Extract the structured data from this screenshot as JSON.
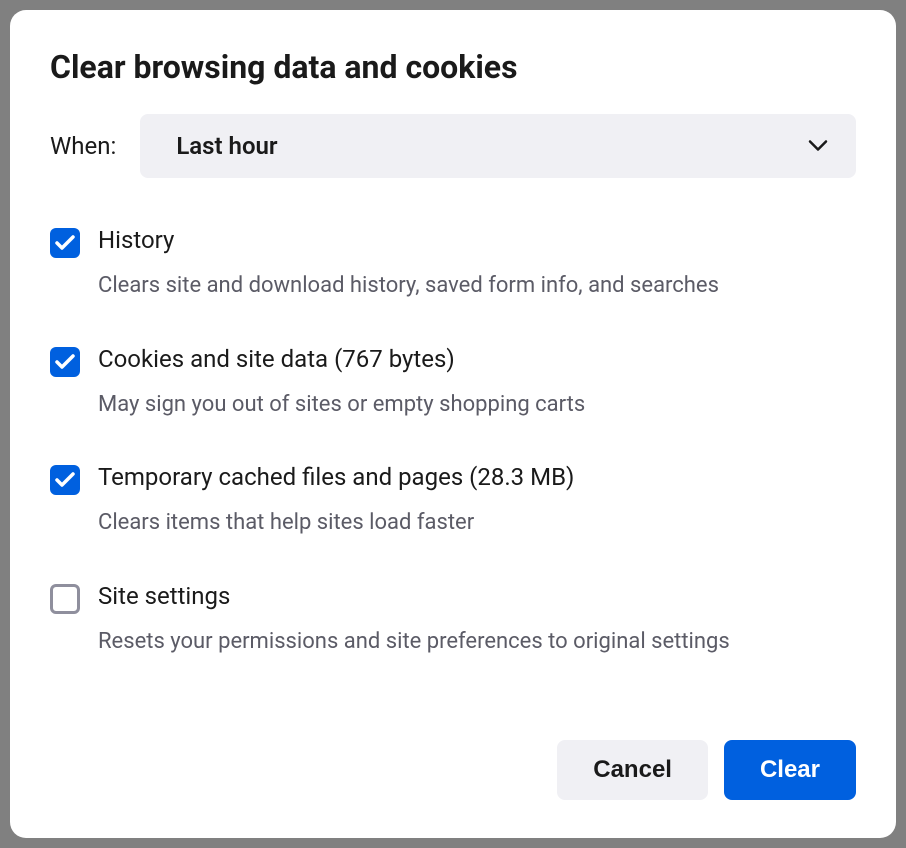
{
  "dialog": {
    "title": "Clear browsing data and cookies",
    "when_label": "When:",
    "when_value": "Last hour",
    "options": [
      {
        "checked": true,
        "label": "History",
        "description": "Clears site and download history, saved form info, and searches"
      },
      {
        "checked": true,
        "label": "Cookies and site data (767 bytes)",
        "description": "May sign you out of sites or empty shopping carts"
      },
      {
        "checked": true,
        "label": "Temporary cached files and pages (28.3 MB)",
        "description": "Clears items that help sites load faster"
      },
      {
        "checked": false,
        "label": "Site settings",
        "description": "Resets your permissions and site preferences to original settings"
      }
    ],
    "buttons": {
      "cancel": "Cancel",
      "clear": "Clear"
    }
  }
}
